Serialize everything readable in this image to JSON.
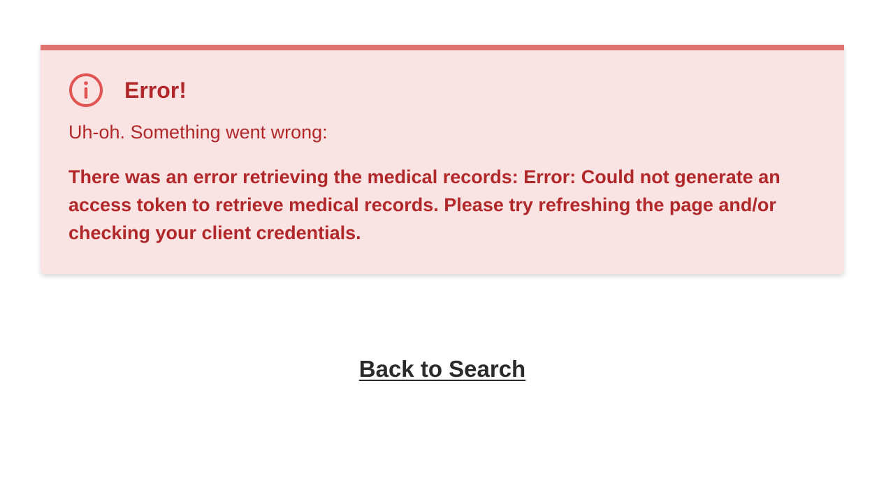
{
  "alert": {
    "icon": "info-circle-icon",
    "title": "Error!",
    "subtitle": "Uh-oh. Something went wrong:",
    "message": "There was an error retrieving the medical records: Error: Could not generate an access token to retrieve medical records. Please try refreshing the page and/or checking your client credentials.",
    "colors": {
      "background": "#fae3e3",
      "border": "#e1736f",
      "text": "#b1282b",
      "icon": "#e05452"
    }
  },
  "back_link": {
    "label": "Back to Search",
    "color": "#2a2a2a"
  }
}
